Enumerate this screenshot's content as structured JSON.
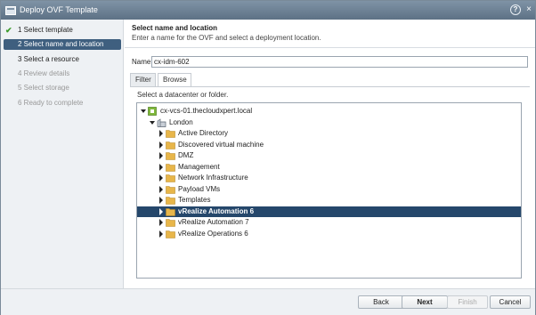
{
  "window": {
    "title": "Deploy OVF Template",
    "help_label": "?",
    "close_label": "×"
  },
  "steps": [
    {
      "number": "1",
      "label": "Select template",
      "state": "done"
    },
    {
      "number": "2",
      "label": "Select name and location",
      "state": "active"
    },
    {
      "number": "3",
      "label": "Select a resource",
      "state": "next"
    },
    {
      "number": "4",
      "label": "Review details",
      "state": "disabled"
    },
    {
      "number": "5",
      "label": "Select storage",
      "state": "disabled"
    },
    {
      "number": "6",
      "label": "Ready to complete",
      "state": "disabled"
    }
  ],
  "main": {
    "heading": "Select name and location",
    "subheading": "Enter a name for the OVF and select a deployment location.",
    "name_label": "Name",
    "name_value": "cx-idm-602",
    "tabs": [
      {
        "label": "Filter",
        "active": false
      },
      {
        "label": "Browse",
        "active": true
      }
    ],
    "instruction": "Select a datacenter or folder."
  },
  "tree": [
    {
      "label": "cx-vcs-01.thecloudxpert.local",
      "type": "vcenter",
      "level": 0,
      "expanded": true,
      "selected": false
    },
    {
      "label": "London",
      "type": "datacenter",
      "level": 1,
      "expanded": true,
      "selected": false
    },
    {
      "label": "Active Directory",
      "type": "folder",
      "level": 2,
      "expanded": false,
      "selected": false
    },
    {
      "label": "Discovered virtual machine",
      "type": "folder",
      "level": 2,
      "expanded": false,
      "selected": false
    },
    {
      "label": "DMZ",
      "type": "folder",
      "level": 2,
      "expanded": false,
      "selected": false
    },
    {
      "label": "Management",
      "type": "folder",
      "level": 2,
      "expanded": false,
      "selected": false
    },
    {
      "label": "Network Infrastructure",
      "type": "folder",
      "level": 2,
      "expanded": false,
      "selected": false
    },
    {
      "label": "Payload VMs",
      "type": "folder",
      "level": 2,
      "expanded": false,
      "selected": false
    },
    {
      "label": "Templates",
      "type": "folder",
      "level": 2,
      "expanded": false,
      "selected": false
    },
    {
      "label": "vRealize Automation 6",
      "type": "folder",
      "level": 2,
      "expanded": false,
      "selected": true
    },
    {
      "label": "vRealize Automation 7",
      "type": "folder",
      "level": 2,
      "expanded": false,
      "selected": false
    },
    {
      "label": "vRealize Operations 6",
      "type": "folder",
      "level": 2,
      "expanded": false,
      "selected": false
    }
  ],
  "footer": {
    "back_label": "Back",
    "next_label": "Next",
    "finish_label": "Finish",
    "cancel_label": "Cancel"
  },
  "colors": {
    "titlebar": "#6a7e92",
    "active_step": "#3f5f7f",
    "selected_row": "#25476b",
    "folder": "#e8b64a",
    "check": "#3a9a2a"
  }
}
